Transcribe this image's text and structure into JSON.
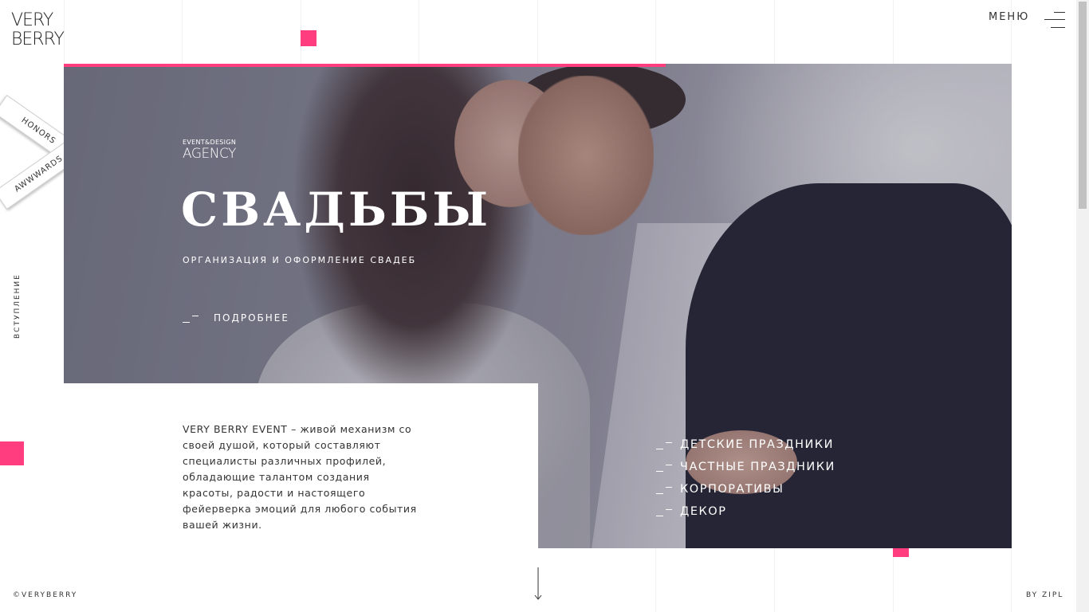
{
  "brand": {
    "logo_line1": "VERY",
    "logo_line2": "BERRY"
  },
  "menu": {
    "label": "МЕНЮ"
  },
  "award": {
    "ribbon_top": "HONORS",
    "ribbon_bottom": "AWWWARDS"
  },
  "side": {
    "section_label": "ВСТУПЛЕНИЕ"
  },
  "hero": {
    "agency_small": "EVENT&DESIGN",
    "agency_big": "AGENCY",
    "title": "СВАДЬБЫ",
    "subtitle": "ОРГАНИЗАЦИЯ И ОФОРМЛЕНИЕ СВАДЕБ",
    "more_label": "ПОДРОБНЕЕ"
  },
  "services": [
    {
      "label": "ДЕТСКИЕ ПРАЗДНИКИ"
    },
    {
      "label": "ЧАСТНЫЕ ПРАЗДНИКИ"
    },
    {
      "label": "КОРПОРАТИВЫ"
    },
    {
      "label": "ДЕКОР"
    }
  ],
  "about": {
    "text": "VERY BERRY EVENT – живой механизм со своей душой, который составляют специалисты различных профилей, обладающие талантом создания красоты, радости и настоящего фейерверка эмоций для любого события вашей жизни."
  },
  "footer": {
    "copyright": "©VERYBERRY",
    "credit": "BY ZIPL"
  },
  "colors": {
    "accent": "#ff3d7f",
    "text": "#2b2b2b",
    "suit": "#262535"
  },
  "icons": [
    "hamburger-icon",
    "dash-icon",
    "arrow-down-icon"
  ]
}
